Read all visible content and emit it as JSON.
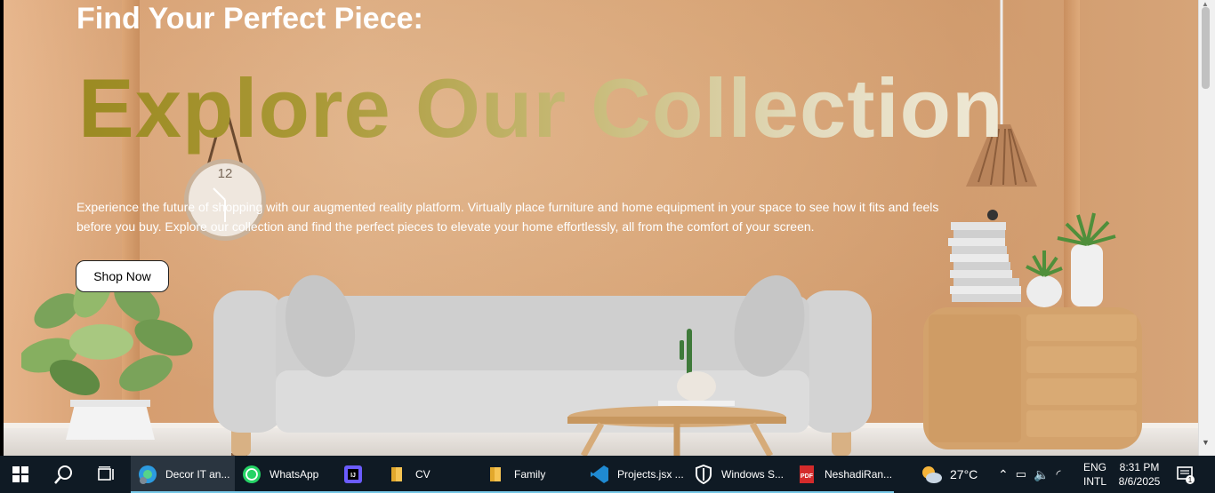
{
  "hero": {
    "title": "Find Your Perfect Piece:",
    "headline": "Explore Our Collection",
    "description": "Experience the future of shopping with our augmented reality platform. Virtually place furniture and home equipment in your space to see how it fits and feels before you buy. Explore our collection and find the perfect pieces to elevate your home effortlessly, all from the comfort of your screen.",
    "cta": "Shop Now"
  },
  "clock": {
    "numeral": "12"
  },
  "taskbar": {
    "apps": [
      {
        "label": "Decor IT an...",
        "icon": "edge-icon",
        "active": true
      },
      {
        "label": "WhatsApp",
        "icon": "whatsapp-icon",
        "active": false
      },
      {
        "label": "",
        "icon": "intellij-icon",
        "active": false
      },
      {
        "label": "CV",
        "icon": "folder-icon",
        "active": false
      },
      {
        "label": "Family",
        "icon": "folder-icon",
        "active": false
      },
      {
        "label": "Projects.jsx ...",
        "icon": "vscode-icon",
        "active": false
      },
      {
        "label": "Windows S...",
        "icon": "windows-security-icon",
        "active": false
      },
      {
        "label": "NeshadiRan...",
        "icon": "pdf-icon",
        "active": false
      }
    ],
    "weather": "27°C",
    "language": "ENG",
    "layout": "INTL",
    "time": "8:31 PM",
    "date": "8/6/2025",
    "notifications": "1"
  },
  "colors": {
    "wall": "#d5a071",
    "headline_start": "#9b8a22",
    "headline_end": "#efe9d6",
    "taskbar": "#0f1a24",
    "taskbar_accent": "#78c9e8"
  }
}
